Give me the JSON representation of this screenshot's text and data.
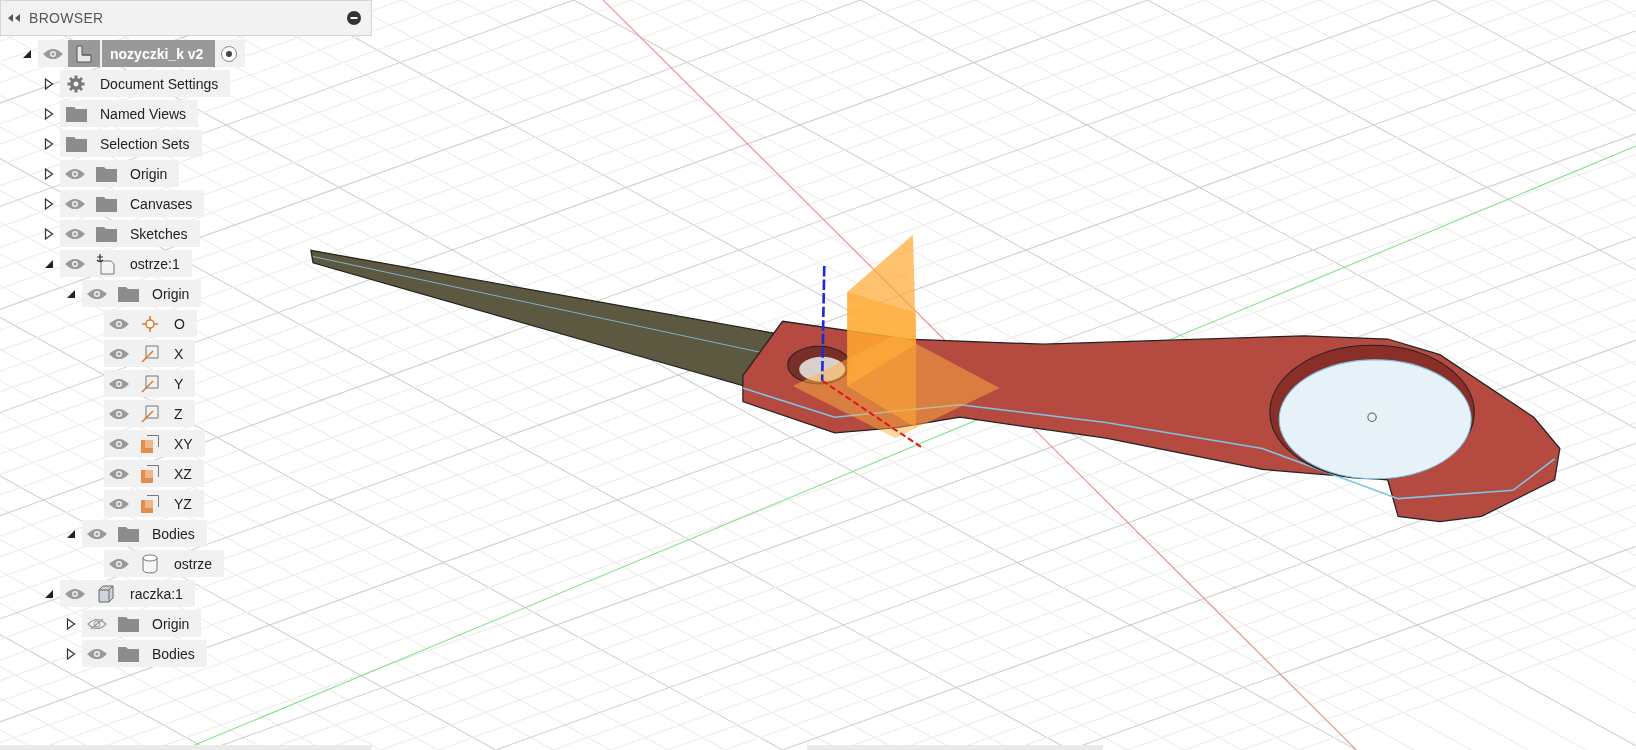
{
  "browser": {
    "title": "BROWSER",
    "items": [
      {
        "label": "nozyczki_k v2",
        "kind": "document",
        "expanded": true,
        "visible": true,
        "active": true,
        "children": [
          {
            "label": "Document Settings",
            "kind": "settings",
            "expanded": false
          },
          {
            "label": "Named Views",
            "kind": "folder",
            "expanded": false
          },
          {
            "label": "Selection Sets",
            "kind": "folder",
            "expanded": false
          },
          {
            "label": "Origin",
            "kind": "folder",
            "expanded": false,
            "visible": true
          },
          {
            "label": "Canvases",
            "kind": "folder",
            "expanded": false,
            "visible": true
          },
          {
            "label": "Sketches",
            "kind": "folder",
            "expanded": false,
            "visible": true
          },
          {
            "label": "ostrze:1",
            "kind": "grounded-component",
            "expanded": true,
            "visible": true,
            "children": [
              {
                "label": "Origin",
                "kind": "folder",
                "expanded": true,
                "visible": true,
                "children": [
                  {
                    "label": "O",
                    "kind": "point",
                    "visible": true
                  },
                  {
                    "label": "X",
                    "kind": "axis",
                    "visible": true
                  },
                  {
                    "label": "Y",
                    "kind": "axis",
                    "visible": true
                  },
                  {
                    "label": "Z",
                    "kind": "axis",
                    "visible": true
                  },
                  {
                    "label": "XY",
                    "kind": "plane",
                    "visible": true
                  },
                  {
                    "label": "XZ",
                    "kind": "plane",
                    "visible": true
                  },
                  {
                    "label": "YZ",
                    "kind": "plane",
                    "visible": true
                  }
                ]
              },
              {
                "label": "Bodies",
                "kind": "folder",
                "expanded": true,
                "visible": true,
                "children": [
                  {
                    "label": "ostrze",
                    "kind": "body",
                    "visible": true
                  }
                ]
              }
            ]
          },
          {
            "label": "raczka:1",
            "kind": "component",
            "expanded": true,
            "visible": true,
            "children": [
              {
                "label": "Origin",
                "kind": "folder",
                "expanded": false,
                "visible": false
              },
              {
                "label": "Bodies",
                "kind": "folder",
                "expanded": false,
                "visible": true
              }
            ]
          }
        ]
      }
    ]
  }
}
